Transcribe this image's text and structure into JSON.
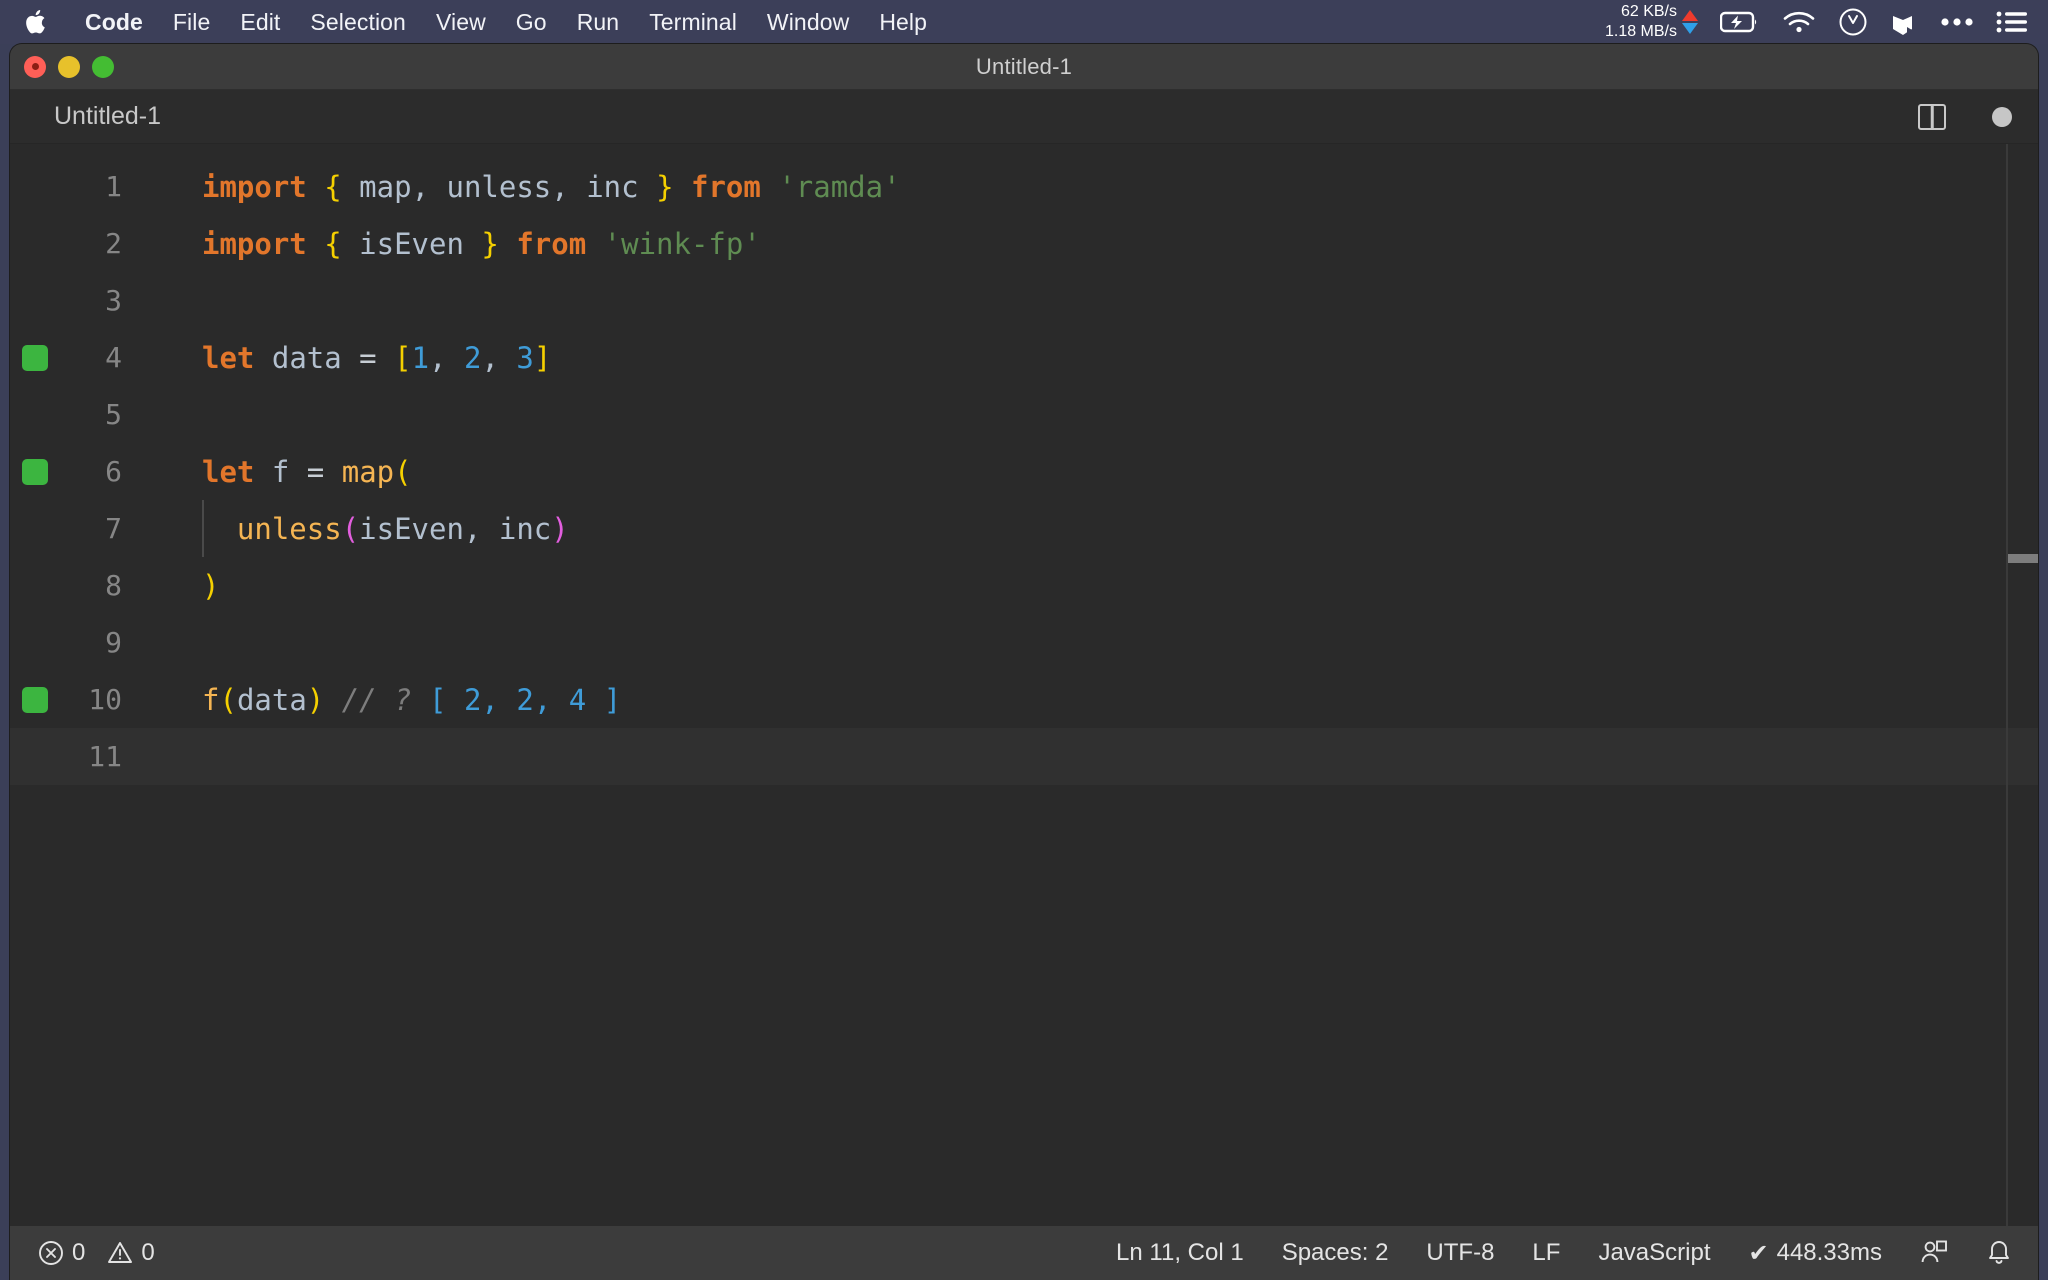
{
  "menubar": {
    "apple_icon": "apple-logo",
    "items": [
      {
        "label": "Code",
        "bold": true
      },
      {
        "label": "File",
        "bold": false
      },
      {
        "label": "Edit",
        "bold": false
      },
      {
        "label": "Selection",
        "bold": false
      },
      {
        "label": "View",
        "bold": false
      },
      {
        "label": "Go",
        "bold": false
      },
      {
        "label": "Run",
        "bold": false
      },
      {
        "label": "Terminal",
        "bold": false
      },
      {
        "label": "Window",
        "bold": false
      },
      {
        "label": "Help",
        "bold": false
      }
    ],
    "network": {
      "upload": "62 KB/s",
      "download": "1.18 MB/s"
    },
    "icons": [
      "battery-charging-icon",
      "wifi-icon",
      "clock-icon",
      "dropbox-icon",
      "ellipsis-icon",
      "control-center-icon"
    ]
  },
  "window": {
    "title": "Untitled-1",
    "traffic_lights": [
      "close-button",
      "minimize-button",
      "maximize-button"
    ]
  },
  "tabstrip": {
    "tab_label": "Untitled-1",
    "split_icon": "split-editor-icon",
    "dirty_indicator": "unsaved-dot-icon"
  },
  "editor": {
    "language": "JavaScript",
    "lines": [
      {
        "no": "1",
        "marker": false,
        "indent_guide": false,
        "tokens": [
          {
            "t": "import",
            "c": "kw"
          },
          {
            "t": " ",
            "c": "op"
          },
          {
            "t": "{",
            "c": "br-y"
          },
          {
            "t": " ",
            "c": "op"
          },
          {
            "t": "map",
            "c": "ident"
          },
          {
            "t": ",",
            "c": "punct"
          },
          {
            "t": " ",
            "c": "op"
          },
          {
            "t": "unless",
            "c": "ident"
          },
          {
            "t": ",",
            "c": "punct"
          },
          {
            "t": " ",
            "c": "op"
          },
          {
            "t": "inc",
            "c": "ident"
          },
          {
            "t": " ",
            "c": "op"
          },
          {
            "t": "}",
            "c": "br-y"
          },
          {
            "t": " ",
            "c": "op"
          },
          {
            "t": "from",
            "c": "kw"
          },
          {
            "t": " ",
            "c": "op"
          },
          {
            "t": "'ramda'",
            "c": "str"
          }
        ]
      },
      {
        "no": "2",
        "marker": false,
        "indent_guide": false,
        "tokens": [
          {
            "t": "import",
            "c": "kw"
          },
          {
            "t": " ",
            "c": "op"
          },
          {
            "t": "{",
            "c": "br-y"
          },
          {
            "t": " ",
            "c": "op"
          },
          {
            "t": "isEven",
            "c": "ident"
          },
          {
            "t": " ",
            "c": "op"
          },
          {
            "t": "}",
            "c": "br-y"
          },
          {
            "t": " ",
            "c": "op"
          },
          {
            "t": "from",
            "c": "kw"
          },
          {
            "t": " ",
            "c": "op"
          },
          {
            "t": "'wink-fp'",
            "c": "str"
          }
        ]
      },
      {
        "no": "3",
        "marker": false,
        "indent_guide": false,
        "tokens": []
      },
      {
        "no": "4",
        "marker": true,
        "indent_guide": false,
        "tokens": [
          {
            "t": "let",
            "c": "kw"
          },
          {
            "t": " ",
            "c": "op"
          },
          {
            "t": "data",
            "c": "ident"
          },
          {
            "t": " ",
            "c": "op"
          },
          {
            "t": "=",
            "c": "op"
          },
          {
            "t": " ",
            "c": "op"
          },
          {
            "t": "[",
            "c": "br-y"
          },
          {
            "t": "1",
            "c": "num"
          },
          {
            "t": ",",
            "c": "punct"
          },
          {
            "t": " ",
            "c": "op"
          },
          {
            "t": "2",
            "c": "num"
          },
          {
            "t": ",",
            "c": "punct"
          },
          {
            "t": " ",
            "c": "op"
          },
          {
            "t": "3",
            "c": "num"
          },
          {
            "t": "]",
            "c": "br-y"
          }
        ]
      },
      {
        "no": "5",
        "marker": false,
        "indent_guide": false,
        "tokens": []
      },
      {
        "no": "6",
        "marker": true,
        "indent_guide": false,
        "tokens": [
          {
            "t": "let",
            "c": "kw"
          },
          {
            "t": " ",
            "c": "op"
          },
          {
            "t": "f",
            "c": "ident"
          },
          {
            "t": " ",
            "c": "op"
          },
          {
            "t": "=",
            "c": "op"
          },
          {
            "t": " ",
            "c": "op"
          },
          {
            "t": "map",
            "c": "fn"
          },
          {
            "t": "(",
            "c": "br-y"
          }
        ]
      },
      {
        "no": "7",
        "marker": false,
        "indent_guide": true,
        "tokens": [
          {
            "t": "  ",
            "c": "op"
          },
          {
            "t": "unless",
            "c": "fn"
          },
          {
            "t": "(",
            "c": "br-m"
          },
          {
            "t": "isEven",
            "c": "ident"
          },
          {
            "t": ",",
            "c": "punct"
          },
          {
            "t": " ",
            "c": "op"
          },
          {
            "t": "inc",
            "c": "ident"
          },
          {
            "t": ")",
            "c": "br-m"
          }
        ]
      },
      {
        "no": "8",
        "marker": false,
        "indent_guide": false,
        "tokens": [
          {
            "t": ")",
            "c": "br-y"
          }
        ]
      },
      {
        "no": "9",
        "marker": false,
        "indent_guide": false,
        "tokens": []
      },
      {
        "no": "10",
        "marker": true,
        "indent_guide": false,
        "tokens": [
          {
            "t": "f",
            "c": "fn"
          },
          {
            "t": "(",
            "c": "br-y"
          },
          {
            "t": "data",
            "c": "ident"
          },
          {
            "t": ")",
            "c": "br-y"
          },
          {
            "t": " ",
            "c": "op"
          },
          {
            "t": "// ?",
            "c": "cmt"
          },
          {
            "t": " ",
            "c": "op"
          },
          {
            "t": "[ ",
            "c": "br-b"
          },
          {
            "t": "2",
            "c": "num"
          },
          {
            "t": ",",
            "c": "br-b"
          },
          {
            "t": " ",
            "c": "op"
          },
          {
            "t": "2",
            "c": "num"
          },
          {
            "t": ",",
            "c": "br-b"
          },
          {
            "t": " ",
            "c": "op"
          },
          {
            "t": "4",
            "c": "num"
          },
          {
            "t": " ]",
            "c": "br-b"
          }
        ]
      },
      {
        "no": "11",
        "marker": false,
        "indent_guide": false,
        "current": true,
        "tokens": []
      }
    ]
  },
  "statusbar": {
    "errors": "0",
    "warnings": "0",
    "cursor": "Ln 11, Col 1",
    "indentation": "Spaces: 2",
    "encoding": "UTF-8",
    "eol": "LF",
    "language": "JavaScript",
    "runtime": "448.33ms",
    "runtime_check": "✔",
    "icons": [
      "error-icon",
      "warning-icon",
      "live-share-icon",
      "bell-icon"
    ]
  }
}
